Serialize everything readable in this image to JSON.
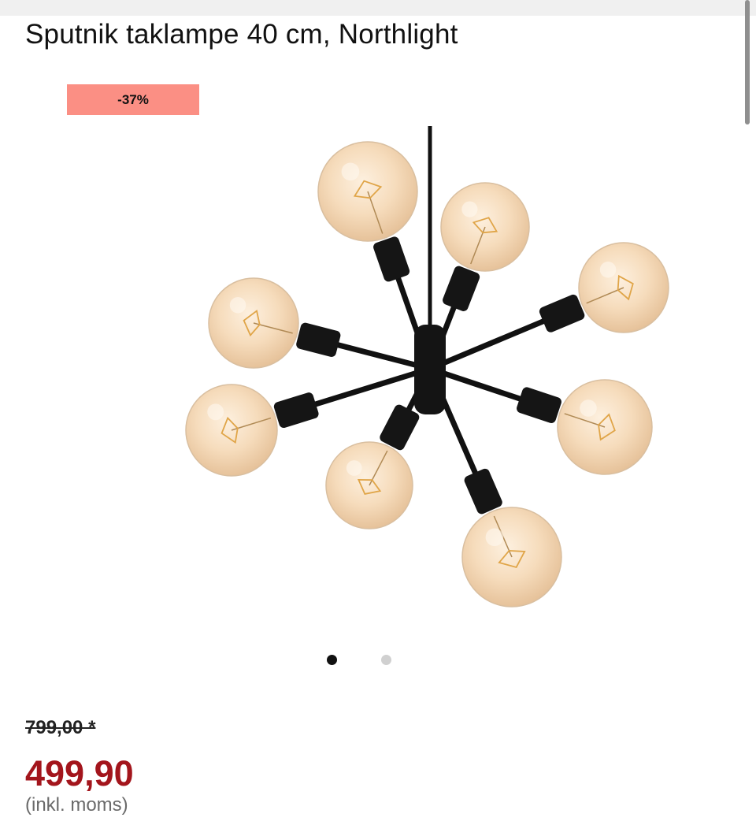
{
  "product": {
    "title": "Sputnik taklampe 40 cm, Northlight",
    "discount_badge": "-37%",
    "old_price": "799,00 *",
    "price": "499,90",
    "vat_note": "(inkl. moms)"
  },
  "gallery": {
    "image_count": 2,
    "active_index": 1
  },
  "colors": {
    "badge_bg": "#fb8f84",
    "price": "#a3151c"
  },
  "icons": {
    "lamp_image": "sputnik-chandelier-image"
  }
}
